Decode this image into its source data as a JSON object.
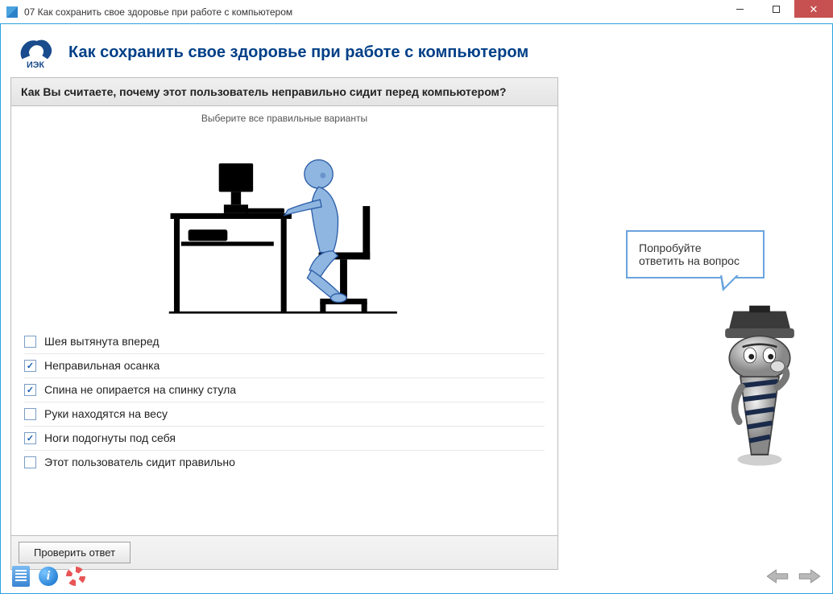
{
  "window": {
    "title": "07 Как сохранить свое здоровье при работе с компьютером"
  },
  "logotext": "ИЭК",
  "page_title": "Как сохранить свое здоровье при работе с компьютером",
  "quiz": {
    "question": "Как Вы считаете, почему этот пользователь неправильно сидит перед компьютером?",
    "instruction": "Выберите все правильные варианты",
    "options": [
      {
        "label": "Шея вытянута вперед",
        "checked": false
      },
      {
        "label": "Неправильная осанка",
        "checked": true
      },
      {
        "label": "Спина не опирается на спинку стула",
        "checked": true
      },
      {
        "label": "Руки находятся на весу",
        "checked": false
      },
      {
        "label": "Ноги подогнуты под себя",
        "checked": true
      },
      {
        "label": "Этот пользователь сидит правильно",
        "checked": false
      }
    ],
    "check_button": "Проверить ответ"
  },
  "speech": {
    "line1": "Попробуйте",
    "line2": "ответить на вопрос"
  }
}
